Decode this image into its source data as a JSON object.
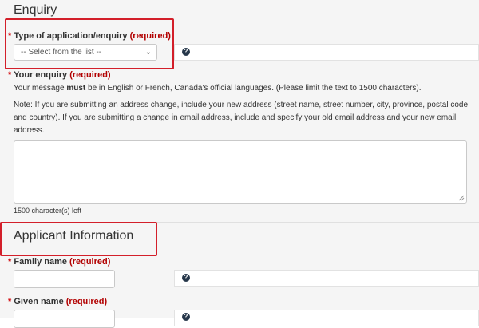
{
  "enquiry_section": {
    "title": "Enquiry",
    "type_field": {
      "star": "*",
      "label": "Type of application/enquiry",
      "required": "(required)",
      "select_value": "-- Select from the list --",
      "help": "?"
    },
    "your_enquiry": {
      "star": "*",
      "label": "Your enquiry",
      "required": "(required)",
      "message_pre": "Your message ",
      "message_bold": "must",
      "message_post": " be in English or French, Canada's official languages. (Please limit the text to 1500 characters).",
      "note_line1": "Note: If you are submitting an address change, include your new address (street name, street number, city, province, postal code",
      "note_line2": "and country). If you are submitting a change in email address, include and specify your old email address and your new email",
      "note_line3": "address.",
      "chars_left": "1500 character(s) left"
    }
  },
  "applicant_section": {
    "title": "Applicant Information",
    "family_name": {
      "star": "*",
      "label": "Family name",
      "required": "(required)",
      "help": "?"
    },
    "given_name": {
      "star": "*",
      "label": "Given name",
      "required": "(required)",
      "help": "?"
    }
  },
  "colors": {
    "highlight_box": "#d31f2a",
    "required_text": "#b20000",
    "help_icon": "#26374a"
  }
}
